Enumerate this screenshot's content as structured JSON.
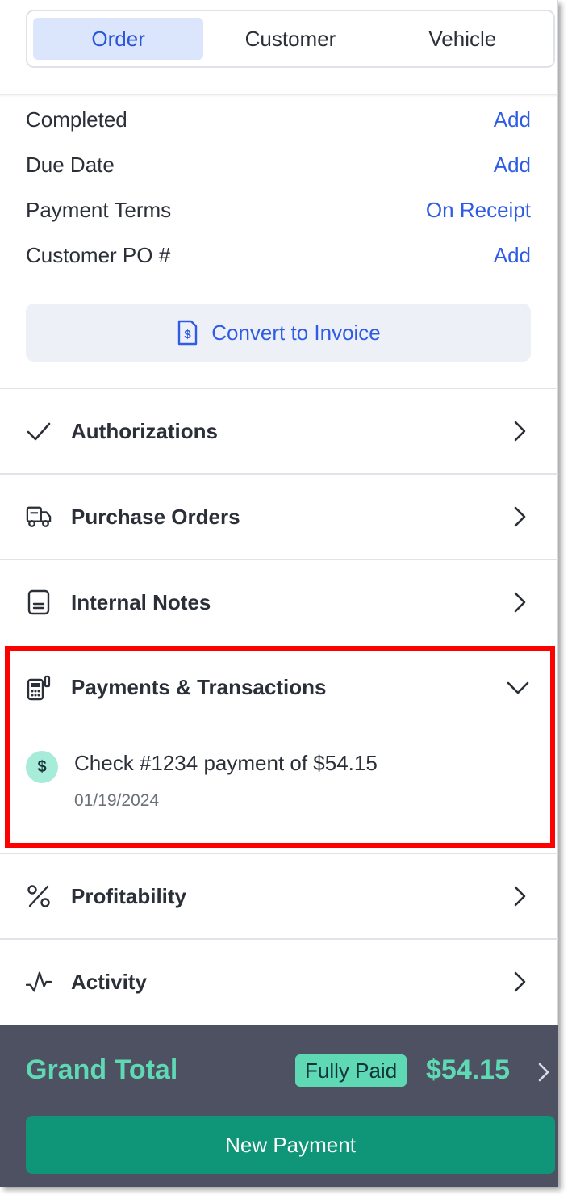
{
  "tabs": [
    {
      "label": "Order",
      "active": true
    },
    {
      "label": "Customer",
      "active": false
    },
    {
      "label": "Vehicle",
      "active": false
    }
  ],
  "details": [
    {
      "label": "Completed",
      "value": "Add"
    },
    {
      "label": "Due Date",
      "value": "Add"
    },
    {
      "label": "Payment Terms",
      "value": "On Receipt"
    },
    {
      "label": "Customer PO #",
      "value": "Add"
    }
  ],
  "convert_button": {
    "label": "Convert to Invoice",
    "icon": "invoice-dollar-icon"
  },
  "sections": [
    {
      "title": "Authorizations",
      "icon": "check-icon"
    },
    {
      "title": "Purchase Orders",
      "icon": "truck-icon"
    },
    {
      "title": "Internal Notes",
      "icon": "notes-icon"
    },
    {
      "title": "Payments & Transactions",
      "icon": "card-terminal-icon",
      "expanded": true
    },
    {
      "title": "Profitability",
      "icon": "percent-icon"
    },
    {
      "title": "Activity",
      "icon": "activity-icon"
    }
  ],
  "payments": [
    {
      "badge": "$",
      "text": "Check #1234 payment of $54.15",
      "date": "01/19/2024"
    }
  ],
  "footer": {
    "label": "Grand Total",
    "status": "Fully Paid",
    "amount": "$54.15",
    "button": "New Payment"
  },
  "colors": {
    "accent_blue": "#2f5ce6",
    "highlight_red": "#ff0000",
    "footer_bg": "#4e5162",
    "mint": "#5fd8b4",
    "button_green": "#0f9577"
  }
}
